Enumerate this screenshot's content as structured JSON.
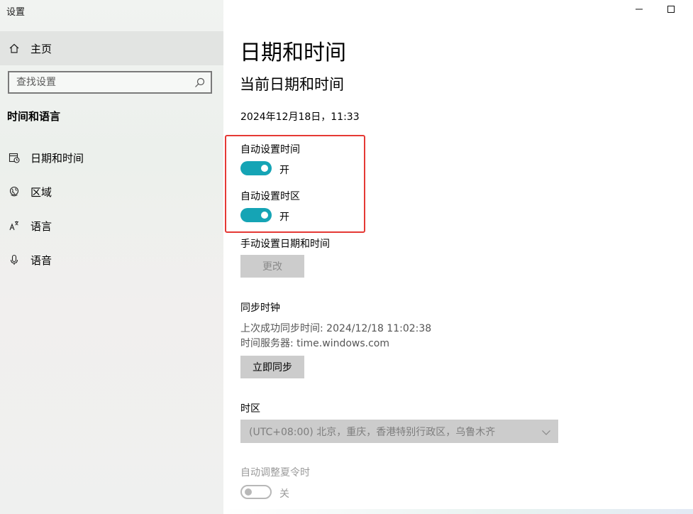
{
  "window": {
    "title": "设置"
  },
  "sidebar": {
    "home_label": "主页",
    "search_placeholder": "查找设置",
    "section_header": "时间和语言",
    "items": [
      {
        "label": "日期和时间",
        "icon": "calendar-clock-icon"
      },
      {
        "label": "区域",
        "icon": "globe-icon"
      },
      {
        "label": "语言",
        "icon": "language-icon"
      },
      {
        "label": "语音",
        "icon": "microphone-icon"
      }
    ]
  },
  "main": {
    "title": "日期和时间",
    "subtitle": "当前日期和时间",
    "current_datetime": "2024年12月18日，11:33",
    "auto_time": {
      "label": "自动设置时间",
      "state": "开",
      "on": true
    },
    "auto_timezone": {
      "label": "自动设置时区",
      "state": "开",
      "on": true
    },
    "manual": {
      "label": "手动设置日期和时间",
      "button": "更改"
    },
    "sync": {
      "label": "同步时钟",
      "last_sync": "上次成功同步时间: 2024/12/18 11:02:38",
      "server": "时间服务器: time.windows.com",
      "button": "立即同步"
    },
    "timezone": {
      "label": "时区",
      "value": "(UTC+08:00) 北京，重庆，香港特别行政区，乌鲁木齐"
    },
    "dst": {
      "label": "自动调整夏令时",
      "state": "关",
      "on": false
    }
  },
  "colors": {
    "accent": "#15a4b5",
    "highlight": "#e53935"
  }
}
